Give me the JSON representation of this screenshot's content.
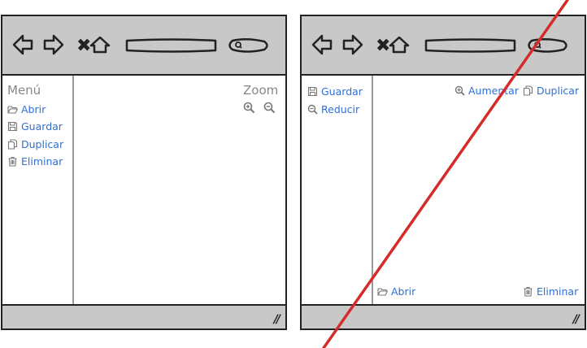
{
  "left": {
    "menu_label": "Menú",
    "zoom_label": "Zoom",
    "items": [
      {
        "label": "Abrir",
        "icon": "folder-open-icon"
      },
      {
        "label": "Guardar",
        "icon": "save-icon"
      },
      {
        "label": "Duplicar",
        "icon": "duplicate-icon"
      },
      {
        "label": "Eliminar",
        "icon": "trash-icon"
      }
    ]
  },
  "right": {
    "sidebar_items": [
      {
        "label": "Guardar",
        "icon": "save-icon"
      },
      {
        "label": "Reducir",
        "icon": "zoom-out-icon"
      }
    ],
    "top_items": [
      {
        "label": "Aumentar",
        "icon": "zoom-in-icon"
      },
      {
        "label": "Duplicar",
        "icon": "duplicate-icon"
      }
    ],
    "bottom_items": [
      {
        "label": "Abrir",
        "icon": "folder-open-icon"
      },
      {
        "label": "Eliminar",
        "icon": "trash-icon"
      }
    ],
    "strike_color": "#d62b2b"
  },
  "colors": {
    "link": "#2f6fd6",
    "bar": "#c8c8c8",
    "outline": "#222222"
  }
}
